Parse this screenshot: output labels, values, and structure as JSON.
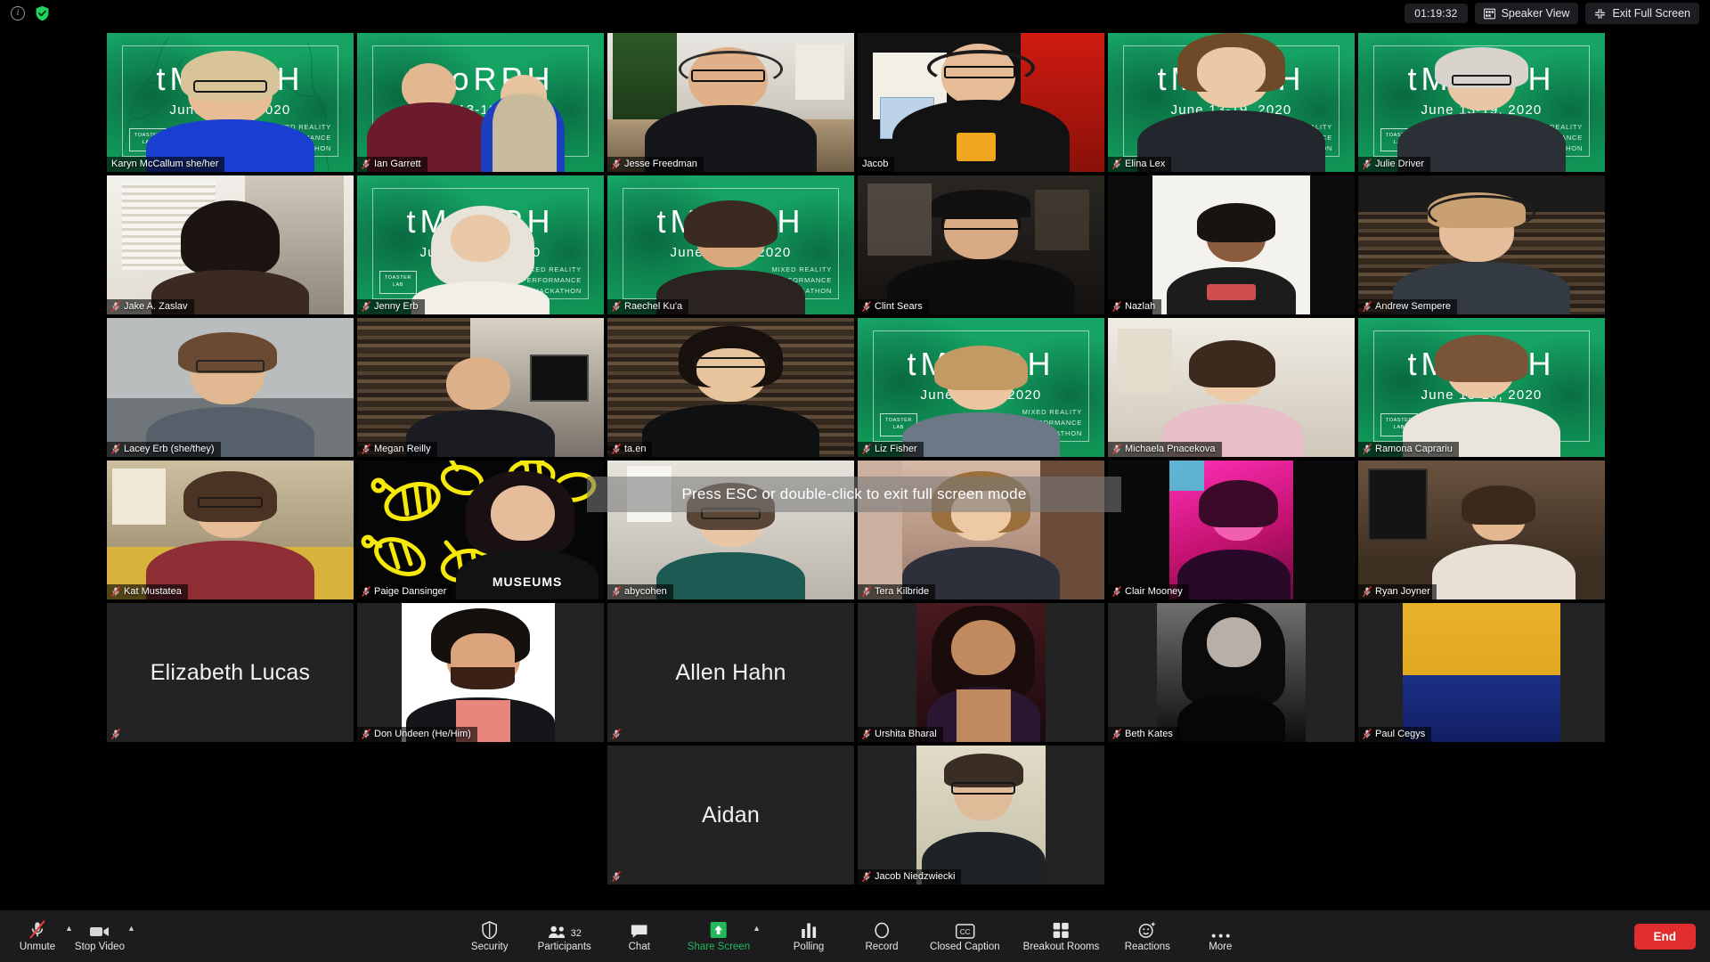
{
  "topbar": {
    "info_icon": "info-icon",
    "encryption_icon": "shield-check-icon",
    "timer": "01:19:32",
    "view_button": "Speaker View",
    "fullscreen_button": "Exit Full Screen"
  },
  "overlay": {
    "fullscreen_hint": "Press ESC or double-click to exit full screen mode"
  },
  "virtual_background": {
    "title": "tMoRPH",
    "date": "June 13-19, 2020",
    "logo_line1": "TOASTER",
    "logo_line2": "LAB",
    "sub_line1": "MIXED REALITY",
    "sub_line2": "PERFORMANCE",
    "sub_line3": "HACKATHON"
  },
  "accent": {
    "active_speaker": "#c9e265",
    "share_screen_green": "#21b95b",
    "end_red": "#e02d2d",
    "mute_red": "#e8393b",
    "tmorph_green": "#14a05f"
  },
  "gallery": {
    "rows": [
      [
        {
          "name": "Karyn McCallum   she/her",
          "muted": false,
          "video": true,
          "bg": "tmorph",
          "active": false
        },
        {
          "name": "Ian Garrett",
          "muted": true,
          "video": true,
          "bg": "tmorph",
          "active": false
        },
        {
          "name": "Jesse Freedman",
          "muted": true,
          "video": true,
          "bg": "room-plant",
          "active": false
        },
        {
          "name": "Jacob",
          "muted": false,
          "video": true,
          "bg": "room-red",
          "active": true
        },
        {
          "name": "Elina Lex",
          "muted": true,
          "video": true,
          "bg": "tmorph",
          "active": false
        },
        {
          "name": "Julie Driver",
          "muted": true,
          "video": true,
          "bg": "tmorph",
          "active": false
        }
      ],
      [
        {
          "name": "Jake A. Zaslav",
          "muted": true,
          "video": true,
          "bg": "room-blinds",
          "active": false
        },
        {
          "name": "Jenny Erb",
          "muted": true,
          "video": true,
          "bg": "tmorph",
          "active": false
        },
        {
          "name": "Raechel Ku'a",
          "muted": true,
          "video": true,
          "bg": "tmorph",
          "active": false
        },
        {
          "name": "Clint Sears",
          "muted": true,
          "video": true,
          "bg": "room-dim",
          "active": false
        },
        {
          "name": "Nazlah",
          "muted": true,
          "video": true,
          "bg": "room-white",
          "active": false
        },
        {
          "name": "Andrew Sempere",
          "muted": true,
          "video": true,
          "bg": "room-shelf",
          "active": false
        }
      ],
      [
        {
          "name": "Lacey Erb (she/they)",
          "muted": true,
          "video": true,
          "bg": "room-grey",
          "active": false
        },
        {
          "name": "Megan Reilly",
          "muted": true,
          "video": true,
          "bg": "room-books",
          "active": false
        },
        {
          "name": "ta.en",
          "muted": true,
          "video": true,
          "bg": "room-shelf",
          "active": false
        },
        {
          "name": "Liz Fisher",
          "muted": true,
          "video": true,
          "bg": "tmorph",
          "active": false
        },
        {
          "name": "Michaela Pnacekova",
          "muted": true,
          "video": true,
          "bg": "room-white",
          "active": false
        },
        {
          "name": "Ramona Caprariu",
          "muted": true,
          "video": true,
          "bg": "tmorph",
          "active": false
        }
      ],
      [
        {
          "name": "Kat Mustatea",
          "muted": true,
          "video": true,
          "bg": "room-yellow",
          "active": false
        },
        {
          "name": "Paige Dansinger",
          "muted": true,
          "video": true,
          "bg": "bees",
          "active": false
        },
        {
          "name": "abycohen",
          "muted": true,
          "video": true,
          "bg": "room-white",
          "active": false
        },
        {
          "name": "Tera Kilbride",
          "muted": true,
          "video": true,
          "bg": "room-pink",
          "active": false
        },
        {
          "name": "Clair Mooney",
          "muted": true,
          "video": true,
          "bg": "room-magenta",
          "active": false
        },
        {
          "name": "Ryan Joyner",
          "muted": true,
          "video": true,
          "bg": "room-studio",
          "active": false
        }
      ],
      [
        {
          "name": "",
          "placeholder": "Elizabeth Lucas",
          "muted": true,
          "video": false,
          "bg": "none",
          "active": false
        },
        {
          "name": "Don Undeen (He/Him)",
          "muted": true,
          "video": true,
          "bg": "portrait-white",
          "active": false
        },
        {
          "name": "",
          "placeholder": "Allen Hahn",
          "muted": true,
          "video": false,
          "bg": "none",
          "active": false
        },
        {
          "name": "Urshita Bharal",
          "muted": true,
          "video": true,
          "bg": "portrait-dark",
          "active": false
        },
        {
          "name": "Beth Kates",
          "muted": true,
          "video": true,
          "bg": "portrait-bw",
          "active": false
        },
        {
          "name": "Paul Cegys",
          "muted": true,
          "video": true,
          "bg": "art-yellow-blue",
          "active": false
        }
      ],
      [
        {
          "name": "",
          "placeholder": "",
          "muted": false,
          "video": false,
          "bg": "none",
          "empty": true,
          "active": false
        },
        {
          "name": "",
          "placeholder": "",
          "muted": false,
          "video": false,
          "bg": "none",
          "empty": true,
          "active": false
        },
        {
          "name": "",
          "placeholder": "Aidan",
          "muted": true,
          "video": false,
          "bg": "none",
          "active": false
        },
        {
          "name": "Jacob Niedzwiecki",
          "muted": true,
          "video": true,
          "bg": "portrait-beige",
          "active": false
        },
        {
          "name": "",
          "placeholder": "",
          "muted": false,
          "video": false,
          "bg": "none",
          "empty": true,
          "active": false
        },
        {
          "name": "",
          "placeholder": "",
          "muted": false,
          "video": false,
          "bg": "none",
          "empty": true,
          "active": false
        }
      ]
    ]
  },
  "toolbar": {
    "mic_label": "Unmute",
    "video_label": "Stop Video",
    "items": [
      {
        "label": "Security",
        "icon": "shield-icon"
      },
      {
        "label": "Participants",
        "icon": "people-icon",
        "count": "32"
      },
      {
        "label": "Chat",
        "icon": "chat-bubble-icon"
      },
      {
        "label": "Share Screen",
        "icon": "share-screen-icon",
        "green": true,
        "caret": true
      },
      {
        "label": "Polling",
        "icon": "bar-chart-icon"
      },
      {
        "label": "Record",
        "icon": "record-circle-icon"
      },
      {
        "label": "Closed Caption",
        "icon": "cc-icon"
      },
      {
        "label": "Breakout Rooms",
        "icon": "grid-squares-icon"
      },
      {
        "label": "Reactions",
        "icon": "smiley-plus-icon"
      },
      {
        "label": "More",
        "icon": "ellipsis-icon"
      }
    ],
    "end_button": "End"
  }
}
